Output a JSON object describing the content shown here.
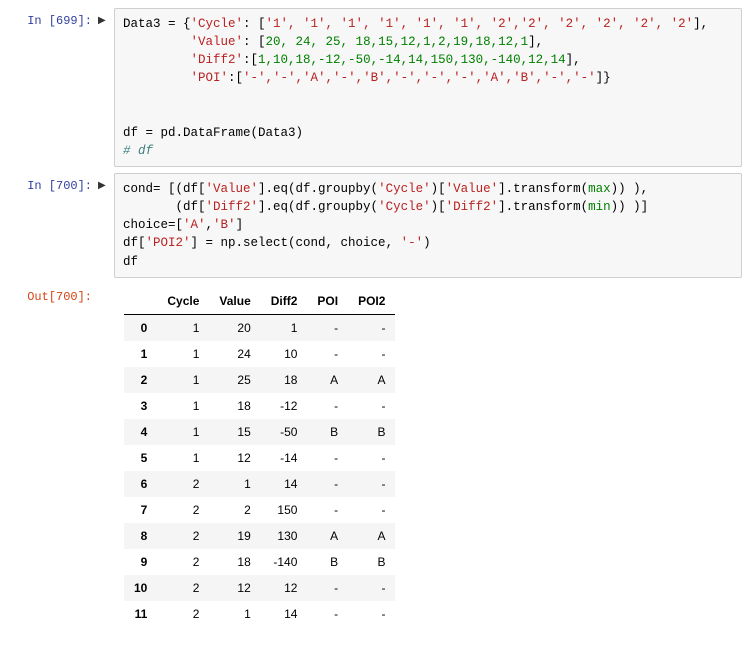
{
  "cells": {
    "in699": {
      "prompt": "In [699]:",
      "code": {
        "l1a": "Data3 = {",
        "l1k1": "'Cycle'",
        "l1p1": ": [",
        "l1v": "'1', '1', '1', '1', '1', '1', '2','2', '2', '2', '2', '2'",
        "l1p2": "],",
        "l2k": "'Value'",
        "l2p1": ": [",
        "l2v": "20, 24, 25, 18,15,12,1,2,19,18,12,1",
        "l2p2": "],",
        "l3k": "'Diff2'",
        "l3p1": ":[",
        "l3v": "1,10,18,-12,-50,-14,14,150,130,-140,12,14",
        "l3p2": "],",
        "l4k": "'POI'",
        "l4p1": ":[",
        "l4v": "'-','-','A','-','B','-','-','-','A','B','-','-'",
        "l4p2": "]}",
        "l5a": "df = pd.DataFrame(Data3)",
        "l6a": "# df"
      }
    },
    "in700": {
      "prompt": "In [700]:",
      "code": {
        "a": "cond= [(df[",
        "v1": "'Value'",
        "b": "].eq(df.groupby(",
        "v2": "'Cycle'",
        "c": ")[",
        "v3": "'Value'",
        "d": "].transform(",
        "fmax": "max",
        "e": ")) ),",
        "f": "       (df[",
        "v4": "'Diff2'",
        "g": "].eq(df.groupby(",
        "v5": "'Cycle'",
        "h": ")[",
        "v6": "'Diff2'",
        "i": "].transform(",
        "fmin": "min",
        "j": ")) )]",
        "k": "choice=[",
        "v7": "'A'",
        "l": ",",
        "v8": "'B'",
        "m": "]",
        "n": "df[",
        "v9": "'POI2'",
        "o": "] = np.select(cond, choice, ",
        "v10": "'-'",
        "p": ")",
        "q": "df"
      }
    },
    "out700": {
      "prompt": "Out[700]:"
    }
  },
  "table": {
    "columns": [
      "Cycle",
      "Value",
      "Diff2",
      "POI",
      "POI2"
    ],
    "index": [
      "0",
      "1",
      "2",
      "3",
      "4",
      "5",
      "6",
      "7",
      "8",
      "9",
      "10",
      "11"
    ],
    "rows": [
      [
        "1",
        "20",
        "1",
        "-",
        "-"
      ],
      [
        "1",
        "24",
        "10",
        "-",
        "-"
      ],
      [
        "1",
        "25",
        "18",
        "A",
        "A"
      ],
      [
        "1",
        "18",
        "-12",
        "-",
        "-"
      ],
      [
        "1",
        "15",
        "-50",
        "B",
        "B"
      ],
      [
        "1",
        "12",
        "-14",
        "-",
        "-"
      ],
      [
        "2",
        "1",
        "14",
        "-",
        "-"
      ],
      [
        "2",
        "2",
        "150",
        "-",
        "-"
      ],
      [
        "2",
        "19",
        "130",
        "A",
        "A"
      ],
      [
        "2",
        "18",
        "-140",
        "B",
        "B"
      ],
      [
        "2",
        "12",
        "12",
        "-",
        "-"
      ],
      [
        "2",
        "1",
        "14",
        "-",
        "-"
      ]
    ]
  }
}
